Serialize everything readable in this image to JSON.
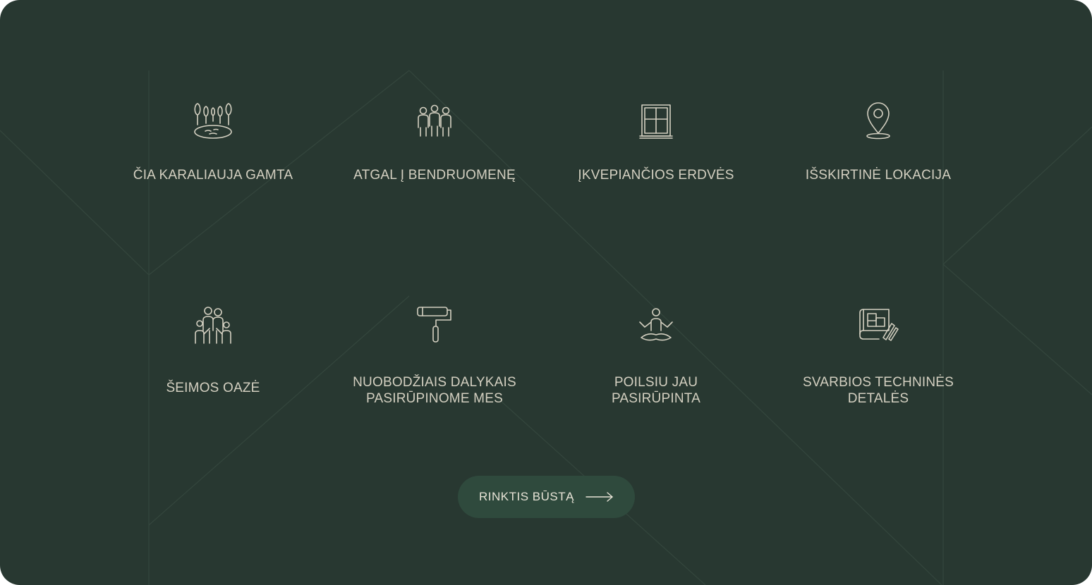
{
  "features": [
    {
      "label": "ČIA KARALIAUJA GAMTA",
      "icon": "trees-lake-icon"
    },
    {
      "label": "ATGAL Į BENDRUOMENĘ",
      "icon": "people-group-icon"
    },
    {
      "label": "ĮKVEPIANČIOS ERDVĖS",
      "icon": "window-icon"
    },
    {
      "label": "IŠSKIRTINĖ LOKACIJA",
      "icon": "location-pin-icon"
    },
    {
      "label": "ŠEIMOS OAZĖ",
      "icon": "family-icon"
    },
    {
      "label": "NUOBODŽIAIS DALYKAIS\nPASIRŪPINOME MES",
      "icon": "paint-roller-icon"
    },
    {
      "label": "POILSIU JAU\nPASIRŪPINTA",
      "icon": "meditation-icon"
    },
    {
      "label": "SVARBIOS TECHNINĖS\nDETALĖS",
      "icon": "blueprint-icon"
    }
  ],
  "cta": {
    "label": "RINKTIS BŪSTĄ",
    "icon": "arrow-right-icon"
  },
  "colors": {
    "background": "#283831",
    "text": "#d4d0c1",
    "button": "#2f4a3d",
    "button_text": "#e7e3d6"
  }
}
